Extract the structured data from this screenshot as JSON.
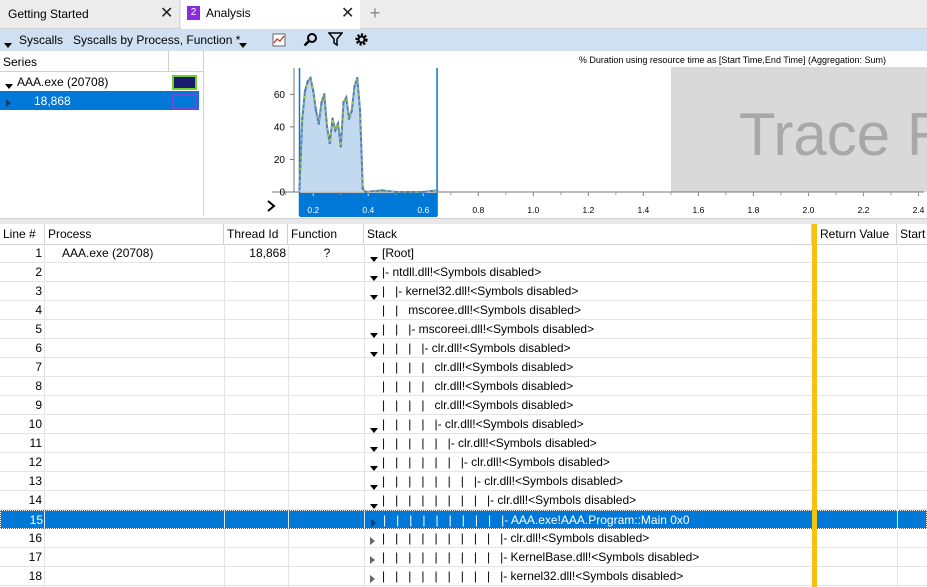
{
  "tabs": [
    {
      "label": "Getting Started",
      "close": "✕"
    },
    {
      "label": "Analysis",
      "number": "2",
      "close": "✕"
    }
  ],
  "new_tab": "+",
  "toolbar": {
    "syscalls_label": "Syscalls",
    "preset_label": "Syscalls by Process, Function *",
    "icons": [
      "chart-icon",
      "search-icon",
      "filter-icon",
      "settings-icon"
    ]
  },
  "series_panel": {
    "header": "Series",
    "items": [
      {
        "label": "AAA.exe (20708)",
        "color": "#1a1a6e"
      },
      {
        "label": "18,868",
        "color": "#0078d7"
      }
    ]
  },
  "chart": {
    "title": "% Duration using resource time as [Start Time,End Time] (Aggregation: Sum)",
    "watermark": "Trace R"
  },
  "chart_data": {
    "type": "area",
    "title": "% Duration using resource time as [Start Time,End Time] (Aggregation: Sum)",
    "xlabel": "",
    "ylabel": "",
    "xlim": [
      0.05,
      2.42
    ],
    "ylim": [
      0,
      78
    ],
    "x_ticks": [
      "0.2",
      "0.4",
      "0.6",
      "0.8",
      "1.0",
      "1.2",
      "1.4",
      "1.6",
      "1.8",
      "2.0",
      "2.2",
      "2.4"
    ],
    "y_ticks": [
      "0",
      "20",
      "40",
      "60"
    ],
    "selection": [
      0.15,
      0.65
    ],
    "series": [
      {
        "name": "AAA.exe (20708)",
        "color": "#4c7cc0",
        "x": [
          0.15,
          0.16,
          0.17,
          0.18,
          0.19,
          0.2,
          0.21,
          0.22,
          0.23,
          0.24,
          0.25,
          0.26,
          0.27,
          0.28,
          0.29,
          0.3,
          0.31,
          0.32,
          0.33,
          0.34,
          0.35,
          0.36,
          0.37,
          0.38,
          0.39,
          0.45,
          0.5,
          0.6,
          0.65
        ],
        "values": [
          2,
          45,
          62,
          68,
          70,
          62,
          50,
          42,
          55,
          60,
          40,
          30,
          45,
          38,
          42,
          28,
          55,
          58,
          45,
          50,
          65,
          70,
          50,
          2,
          0,
          1,
          0,
          0,
          1
        ]
      }
    ]
  },
  "table": {
    "columns": [
      "Line #",
      "Process",
      "Thread Id",
      "Function",
      "Stack",
      "Return Value",
      "Start"
    ],
    "rows": [
      {
        "line": "1",
        "process": "AAA.exe (20708)",
        "thread": "18,868",
        "function": "?",
        "stack": "[Root]",
        "expander": "down"
      },
      {
        "line": "2",
        "process": "",
        "thread": "",
        "function": "",
        "stack": "|- ntdll.dll!<Symbols disabled>",
        "expander": "down"
      },
      {
        "line": "3",
        "process": "",
        "thread": "",
        "function": "",
        "stack": "|   |- kernel32.dll!<Symbols disabled>",
        "expander": "down"
      },
      {
        "line": "4",
        "process": "",
        "thread": "",
        "function": "",
        "stack": "|   |   mscoree.dll!<Symbols disabled>",
        "expander": "none"
      },
      {
        "line": "5",
        "process": "",
        "thread": "",
        "function": "",
        "stack": "|   |   |- mscoreei.dll!<Symbols disabled>",
        "expander": "down"
      },
      {
        "line": "6",
        "process": "",
        "thread": "",
        "function": "",
        "stack": "|   |   |   |- clr.dll!<Symbols disabled>",
        "expander": "down"
      },
      {
        "line": "7",
        "process": "",
        "thread": "",
        "function": "",
        "stack": "|   |   |   |   clr.dll!<Symbols disabled>",
        "expander": "none"
      },
      {
        "line": "8",
        "process": "",
        "thread": "",
        "function": "",
        "stack": "|   |   |   |   clr.dll!<Symbols disabled>",
        "expander": "none"
      },
      {
        "line": "9",
        "process": "",
        "thread": "",
        "function": "",
        "stack": "|   |   |   |   clr.dll!<Symbols disabled>",
        "expander": "none"
      },
      {
        "line": "10",
        "process": "",
        "thread": "",
        "function": "",
        "stack": "|   |   |   |   |- clr.dll!<Symbols disabled>",
        "expander": "down"
      },
      {
        "line": "11",
        "process": "",
        "thread": "",
        "function": "",
        "stack": "|   |   |   |   |   |- clr.dll!<Symbols disabled>",
        "expander": "down"
      },
      {
        "line": "12",
        "process": "",
        "thread": "",
        "function": "",
        "stack": "|   |   |   |   |   |   |- clr.dll!<Symbols disabled>",
        "expander": "down"
      },
      {
        "line": "13",
        "process": "",
        "thread": "",
        "function": "",
        "stack": "|   |   |   |   |   |   |   |- clr.dll!<Symbols disabled>",
        "expander": "down"
      },
      {
        "line": "14",
        "process": "",
        "thread": "",
        "function": "",
        "stack": "|   |   |   |   |   |   |   |   |- clr.dll!<Symbols disabled>",
        "expander": "down"
      },
      {
        "line": "15",
        "process": "",
        "thread": "",
        "function": "",
        "stack": "|   |   |   |   |   |   |   |   |   |- AAA.exe!AAA.Program::Main 0x0",
        "expander": "right",
        "selected": true
      },
      {
        "line": "16",
        "process": "",
        "thread": "",
        "function": "",
        "stack": "|   |   |   |   |   |   |   |   |   |- clr.dll!<Symbols disabled>",
        "expander": "right"
      },
      {
        "line": "17",
        "process": "",
        "thread": "",
        "function": "",
        "stack": "|   |   |   |   |   |   |   |   |   |- KernelBase.dll!<Symbols disabled>",
        "expander": "right"
      },
      {
        "line": "18",
        "process": "",
        "thread": "",
        "function": "",
        "stack": "|   |   |   |   |   |   |   |   |   |- kernel32.dll!<Symbols disabled>",
        "expander": "right"
      }
    ]
  }
}
